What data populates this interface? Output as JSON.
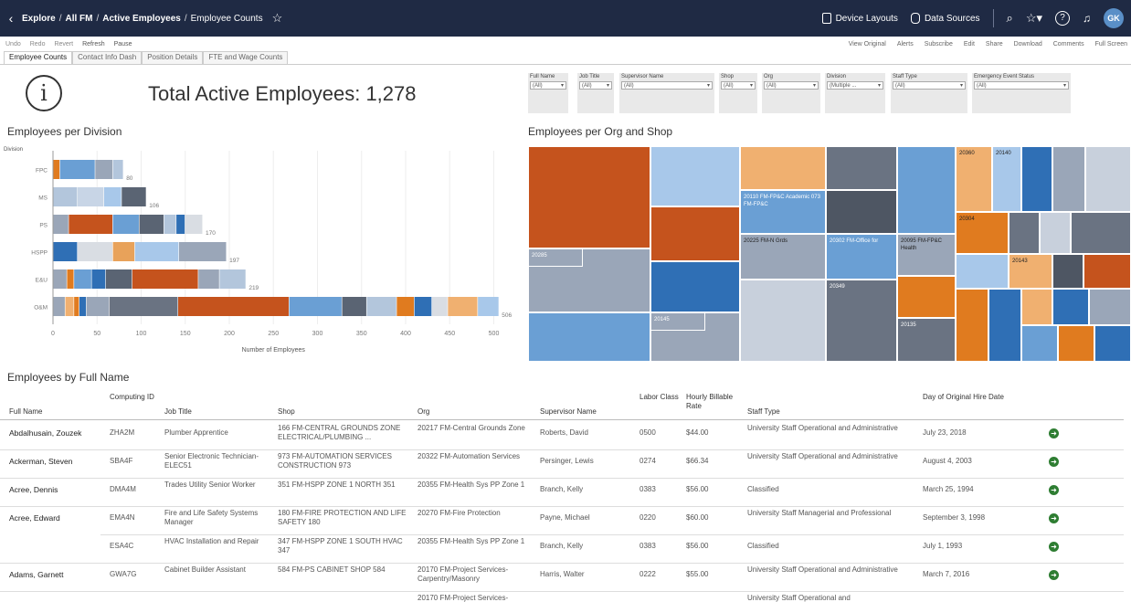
{
  "nav": {
    "breadcrumb": [
      "Explore",
      "All FM",
      "Active Employees"
    ],
    "current": "Employee Counts",
    "device_layouts": "Device Layouts",
    "data_sources": "Data Sources",
    "avatar": "GK"
  },
  "toolbar": {
    "left": [
      "Undo",
      "Redo",
      "Revert",
      "Refresh",
      "Pause"
    ],
    "right": [
      "View Original",
      "Alerts",
      "Subscribe",
      "Edit",
      "Share",
      "Download",
      "Comments",
      "Full Screen"
    ]
  },
  "tabs": [
    "Employee Counts",
    "Contact Info Dash",
    "Position Details",
    "FTE and Wage Counts"
  ],
  "header": {
    "title": "Total Active Employees: 1,278",
    "info_glyph": "i"
  },
  "filters": [
    {
      "label": "Full Name",
      "value": "(All)"
    },
    {
      "label": "Job Title",
      "value": "(All)"
    },
    {
      "label": "Supervisor Name",
      "value": "(All)"
    },
    {
      "label": "Shop",
      "value": "(All)"
    },
    {
      "label": "Org",
      "value": "(All)"
    },
    {
      "label": "Division",
      "value": "(Multiple ..."
    },
    {
      "label": "Staff Type",
      "value": "(All)"
    },
    {
      "label": "Emergency Event Status",
      "value": "(All)"
    }
  ],
  "sections": {
    "division": "Employees per Division",
    "org_shop": "Employees per Org and Shop",
    "by_name": "Employees by Full Name"
  },
  "chart_data": {
    "type": "bar",
    "orientation": "horizontal",
    "stacked": true,
    "ylabel": "Division",
    "xlabel": "Number of Employees",
    "categories": [
      "FPC",
      "MS",
      "PS",
      "HSPP",
      "E&U",
      "O&M"
    ],
    "values": [
      80,
      106,
      170,
      197,
      219,
      506
    ],
    "xticks": [
      0,
      50,
      100,
      150,
      200,
      250,
      300,
      350,
      400,
      450,
      500
    ],
    "xlim": [
      0,
      520
    ],
    "segments": [
      [
        [
          "#e07b1f",
          8
        ],
        [
          "#6a9fd4",
          40
        ],
        [
          "#9aa6b8",
          20
        ],
        [
          "#b3c6dc",
          12
        ]
      ],
      [
        [
          "#b3c6dc",
          28
        ],
        [
          "#c8d5e6",
          30
        ],
        [
          "#a8c8ea",
          20
        ],
        [
          "#5a6473",
          28
        ]
      ],
      [
        [
          "#9aa6b8",
          18
        ],
        [
          "#c5531d",
          50
        ],
        [
          "#6a9fd4",
          30
        ],
        [
          "#5a6473",
          28
        ],
        [
          "#b3c6dc",
          14
        ],
        [
          "#2f6fb5",
          10
        ],
        [
          "#d9dde3",
          20
        ]
      ],
      [
        [
          "#2f6fb5",
          28
        ],
        [
          "#d9dde3",
          40
        ],
        [
          "#e8a25a",
          25
        ],
        [
          "#a8c8ea",
          50
        ],
        [
          "#9aa6b8",
          54
        ]
      ],
      [
        [
          "#9aa6b8",
          16
        ],
        [
          "#e07b1f",
          8
        ],
        [
          "#6a9fd4",
          20
        ],
        [
          "#2f6fb5",
          16
        ],
        [
          "#5a6473",
          30
        ],
        [
          "#c5531d",
          75
        ],
        [
          "#9aa6b8",
          24
        ],
        [
          "#b3c6dc",
          30
        ]
      ],
      [
        [
          "#9aa6b8",
          14
        ],
        [
          "#f0b070",
          10
        ],
        [
          "#e07b1f",
          6
        ],
        [
          "#2f6fb5",
          8
        ],
        [
          "#9aa6b8",
          26
        ],
        [
          "#6a7382",
          78
        ],
        [
          "#c5531d",
          126
        ],
        [
          "#6a9fd4",
          60
        ],
        [
          "#5a6473",
          28
        ],
        [
          "#b3c6dc",
          34
        ],
        [
          "#e07b1f",
          20
        ],
        [
          "#2f6fb5",
          20
        ],
        [
          "#d9dde3",
          18
        ],
        [
          "#f0b070",
          34
        ],
        [
          "#a8c8ea",
          24
        ]
      ]
    ]
  },
  "treemap": {
    "labels": {
      "a": "20110 FM-FP&C Academic 073 FM-FP&C",
      "b": "20225 FM-N Grds",
      "c": "20302 FM-Office for",
      "d": "20095 FM-FP&C Health",
      "e": "20360",
      "f": "20140",
      "g": "20360",
      "h": "20304",
      "i": "20143",
      "j": "20285",
      "k": "20145",
      "l": "20349",
      "m": "20135"
    }
  },
  "table": {
    "headers": [
      "Full Name",
      "Computing ID",
      "Job Title",
      "Shop",
      "Org",
      "Supervisor Name",
      "Labor Class",
      "Hourly Billable Rate",
      "Staff Type",
      "Day of Original Hire Date"
    ],
    "rows": [
      {
        "name": "Abdalhusain, Zouzek",
        "id": "ZHA2M",
        "job": "Plumber Apprentice",
        "shop": "166 FM-CENTRAL GROUNDS ZONE ELECTRICAL/PLUMBING ...",
        "org": "20217 FM-Central Grounds Zone",
        "sup": "Roberts, David",
        "lc": "0500",
        "rate": "$44.00",
        "staff": "University Staff Operational and Administrative",
        "hire": "July 23, 2018"
      },
      {
        "name": "Ackerman, Steven",
        "id": "SBA4F",
        "job": "Senior Electronic Technician-ELEC51",
        "shop": "973 FM-AUTOMATION SERVICES CONSTRUCTION 973",
        "org": "20322 FM-Automation Services",
        "sup": "Persinger, Lewis",
        "lc": "0274",
        "rate": "$66.34",
        "staff": "University Staff Operational and Administrative",
        "hire": "August 4, 2003"
      },
      {
        "name": "Acree, Dennis",
        "id": "DMA4M",
        "job": "Trades Utility Senior Worker",
        "shop": "351 FM-HSPP ZONE 1 NORTH 351",
        "org": "20355 FM-Health Sys PP Zone 1",
        "sup": "Branch, Kelly",
        "lc": "0383",
        "rate": "$56.00",
        "staff": "Classified",
        "hire": "March 25, 1994"
      },
      {
        "name": "Acree, Edward",
        "id": "EMA4N",
        "job": "Fire and Life Safety Systems Manager",
        "shop": "180 FM-FIRE PROTECTION AND LIFE SAFETY 180",
        "org": "20270 FM-Fire Protection",
        "sup": "Payne, Michael",
        "lc": "0220",
        "rate": "$60.00",
        "staff": "University Staff Managerial and Professional",
        "hire": "September 3, 1998"
      },
      {
        "name": "",
        "id": "ESA4C",
        "job": "HVAC Installation and Repair",
        "shop": "347 FM-HSPP ZONE 1 SOUTH HVAC 347",
        "org": "20355 FM-Health Sys PP Zone 1",
        "sup": "Branch, Kelly",
        "lc": "0383",
        "rate": "$56.00",
        "staff": "Classified",
        "hire": "July 1, 1993"
      },
      {
        "name": "Adams, Garnett",
        "id": "GWA7G",
        "job": "Cabinet Builder Assistant",
        "shop": "584 FM-PS CABINET SHOP 584",
        "org": "20170 FM-Project Services-Carpentry/Masonry",
        "sup": "Harris, Walter",
        "lc": "0222",
        "rate": "$55.00",
        "staff": "University Staff Operational and Administrative",
        "hire": "March 7, 2016"
      }
    ],
    "partial_org": "20170 FM-Project Services-",
    "partial_staff": "University Staff Operational and"
  }
}
